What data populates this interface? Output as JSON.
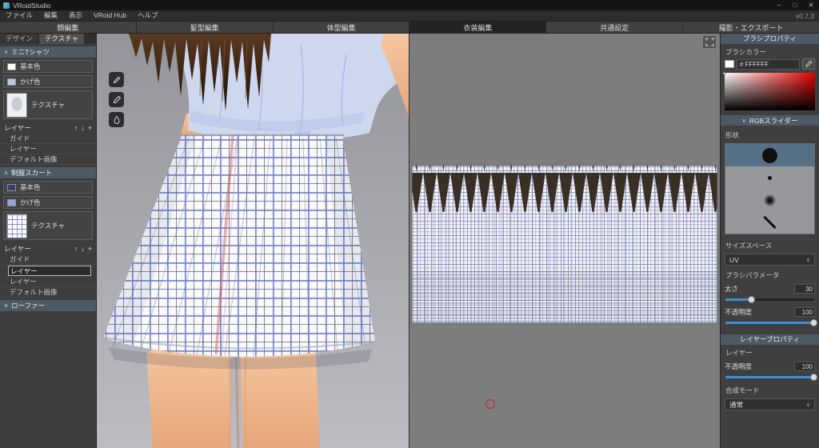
{
  "titlebar": {
    "app_title": "VRoidStudio",
    "minimize_icon": "−",
    "maximize_icon": "□",
    "close_icon": "✕"
  },
  "menubar": {
    "items": [
      {
        "label": "ファイル"
      },
      {
        "label": "編集"
      },
      {
        "label": "表示"
      },
      {
        "label": "VRoid Hub"
      },
      {
        "label": "ヘルプ"
      }
    ],
    "version": "v0.7.3"
  },
  "edit_tabs": [
    {
      "label": "顔編集",
      "active": false
    },
    {
      "label": "髪型編集",
      "active": false
    },
    {
      "label": "体型編集",
      "active": false
    },
    {
      "label": "衣装編集",
      "active": true
    },
    {
      "label": "共通設定",
      "active": false
    },
    {
      "label": "撮影・エクスポート",
      "active": false
    }
  ],
  "icons": {
    "collapse": "∧",
    "expand": "∨",
    "dropdown": "∨",
    "layer_up": "↑",
    "layer_down": "↓",
    "layer_add": "+",
    "sv_cursor": "+"
  },
  "left_panel": {
    "tabs": [
      {
        "label": "デザイン",
        "active": false
      },
      {
        "label": "テクスチャ",
        "active": true
      }
    ],
    "shirt": {
      "title": "ミニTシャツ",
      "base_color": "基本色",
      "shade_color": "かげ色",
      "texture": "テクスチャ",
      "layer_header": "レイヤー",
      "items": [
        {
          "label": "ガイド"
        },
        {
          "label": "レイヤー"
        },
        {
          "label": "デフォルト画像"
        }
      ]
    },
    "skirt": {
      "title": "制服スカート",
      "base_color": "基本色",
      "shade_color": "かげ色",
      "texture": "テクスチャ",
      "layer_header": "レイヤー",
      "guide": "ガイド",
      "layer_editing_value": "レイヤー",
      "layer2": "レイヤー",
      "default_image": "デフォルト画像"
    },
    "loafers": {
      "title": "ローファー"
    }
  },
  "right_panel": {
    "brush_properties_title": "ブラシプロパティ",
    "brush_color_label": "ブラシカラー",
    "brush_color_hex": "# FFFFFF",
    "rgb_slider_title": "RGBスライダー",
    "shape_label": "形状",
    "shapes": [
      {
        "name": "solid-circle",
        "selected": true
      },
      {
        "name": "small-dot",
        "selected": false
      },
      {
        "name": "soft-circle",
        "selected": false
      },
      {
        "name": "diagonal-line",
        "selected": false
      }
    ],
    "size_space_label": "サイズスペース",
    "size_space_value": "UV",
    "brush_params_label": "ブラシパラメータ",
    "thickness_label": "太さ",
    "thickness_value": "30",
    "thickness_fill": "30%",
    "opacity_label": "不透明度",
    "opacity_value": "100",
    "opacity_fill": "100%",
    "layer_properties_title": "レイヤープロパティ",
    "layer_label": "レイヤー",
    "layer_opacity_label": "不透明度",
    "layer_opacity_value": "100",
    "layer_opacity_fill": "100%",
    "blend_mode_label": "合成モード",
    "blend_mode_value": "通常"
  },
  "colors": {
    "accent_blue": "#3e8fd8",
    "panel_header": "#4d5a64",
    "brush_color_swatch": "#ffffff",
    "shirt_base_swatch": "#ffffff",
    "shirt_shade_swatch": "#bcc8ea",
    "skirt_base_swatch": "#34406b",
    "skirt_shade_swatch": "#97a5dc"
  }
}
